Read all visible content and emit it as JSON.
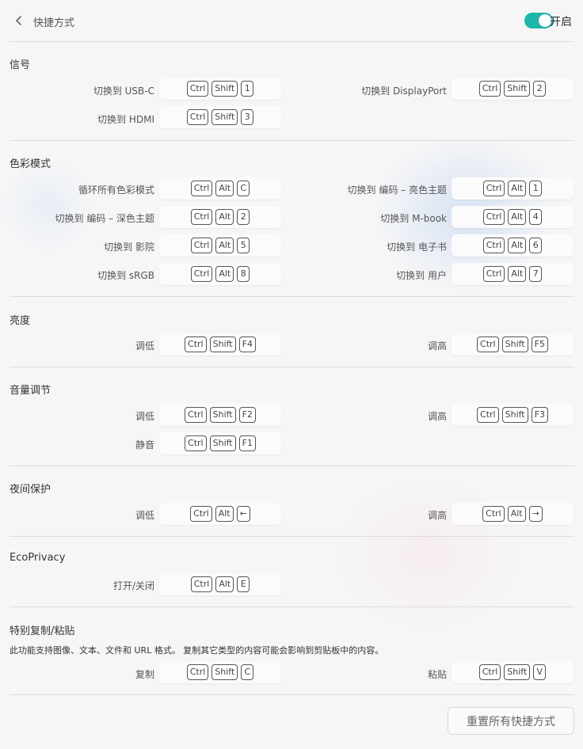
{
  "header": {
    "title": "快捷方式",
    "toggle_label": "开启",
    "toggle_on": true,
    "accent": "#1fb5a8"
  },
  "sections": {
    "signal": {
      "title": "信号",
      "items": [
        {
          "label": "切换到 USB-C",
          "keys": [
            "Ctrl",
            "Shift",
            "1"
          ]
        },
        {
          "label": "切换到 DisplayPort",
          "keys": [
            "Ctrl",
            "Shift",
            "2"
          ]
        },
        {
          "label": "切换到 HDMI",
          "keys": [
            "Ctrl",
            "Shift",
            "3"
          ]
        }
      ]
    },
    "color": {
      "title": "色彩模式",
      "items": [
        {
          "label": "循环所有色彩模式",
          "keys": [
            "Ctrl",
            "Alt",
            "C"
          ]
        },
        {
          "label": "切换到 编码 – 亮色主题",
          "keys": [
            "Ctrl",
            "Alt",
            "1"
          ]
        },
        {
          "label": "切换到 编码 – 深色主题",
          "keys": [
            "Ctrl",
            "Alt",
            "2"
          ]
        },
        {
          "label": "切换到 M-book",
          "keys": [
            "Ctrl",
            "Alt",
            "4"
          ]
        },
        {
          "label": "切换到 影院",
          "keys": [
            "Ctrl",
            "Alt",
            "5"
          ]
        },
        {
          "label": "切换到 电子书",
          "keys": [
            "Ctrl",
            "Alt",
            "6"
          ]
        },
        {
          "label": "切换到 sRGB",
          "keys": [
            "Ctrl",
            "Alt",
            "8"
          ]
        },
        {
          "label": "切换到 用户",
          "keys": [
            "Ctrl",
            "Alt",
            "7"
          ]
        }
      ]
    },
    "brightness": {
      "title": "亮度",
      "items": [
        {
          "label": "调低",
          "keys": [
            "Ctrl",
            "Shift",
            "F4"
          ]
        },
        {
          "label": "调高",
          "keys": [
            "Ctrl",
            "Shift",
            "F5"
          ]
        }
      ]
    },
    "volume": {
      "title": "音量调节",
      "items": [
        {
          "label": "调低",
          "keys": [
            "Ctrl",
            "Shift",
            "F2"
          ]
        },
        {
          "label": "调高",
          "keys": [
            "Ctrl",
            "Shift",
            "F3"
          ]
        },
        {
          "label": "静音",
          "keys": [
            "Ctrl",
            "Shift",
            "F1"
          ]
        }
      ]
    },
    "night": {
      "title": "夜间保护",
      "items": [
        {
          "label": "调低",
          "keys": [
            "Ctrl",
            "Alt",
            "←"
          ]
        },
        {
          "label": "调高",
          "keys": [
            "Ctrl",
            "Alt",
            "→"
          ]
        }
      ]
    },
    "eco": {
      "title": "EcoPrivacy",
      "items": [
        {
          "label": "打开/关闭",
          "keys": [
            "Ctrl",
            "Alt",
            "E"
          ]
        }
      ]
    },
    "paste": {
      "title": "特别复制/粘贴",
      "note": "此功能支持图像、文本、文件和 URL 格式。 复制其它类型的内容可能会影响到剪贴板中的内容。",
      "items": [
        {
          "label": "复制",
          "keys": [
            "Ctrl",
            "Shift",
            "C"
          ]
        },
        {
          "label": "粘贴",
          "keys": [
            "Ctrl",
            "Shift",
            "V"
          ]
        }
      ]
    }
  },
  "footer": {
    "reset_label": "重置所有快捷方式"
  }
}
